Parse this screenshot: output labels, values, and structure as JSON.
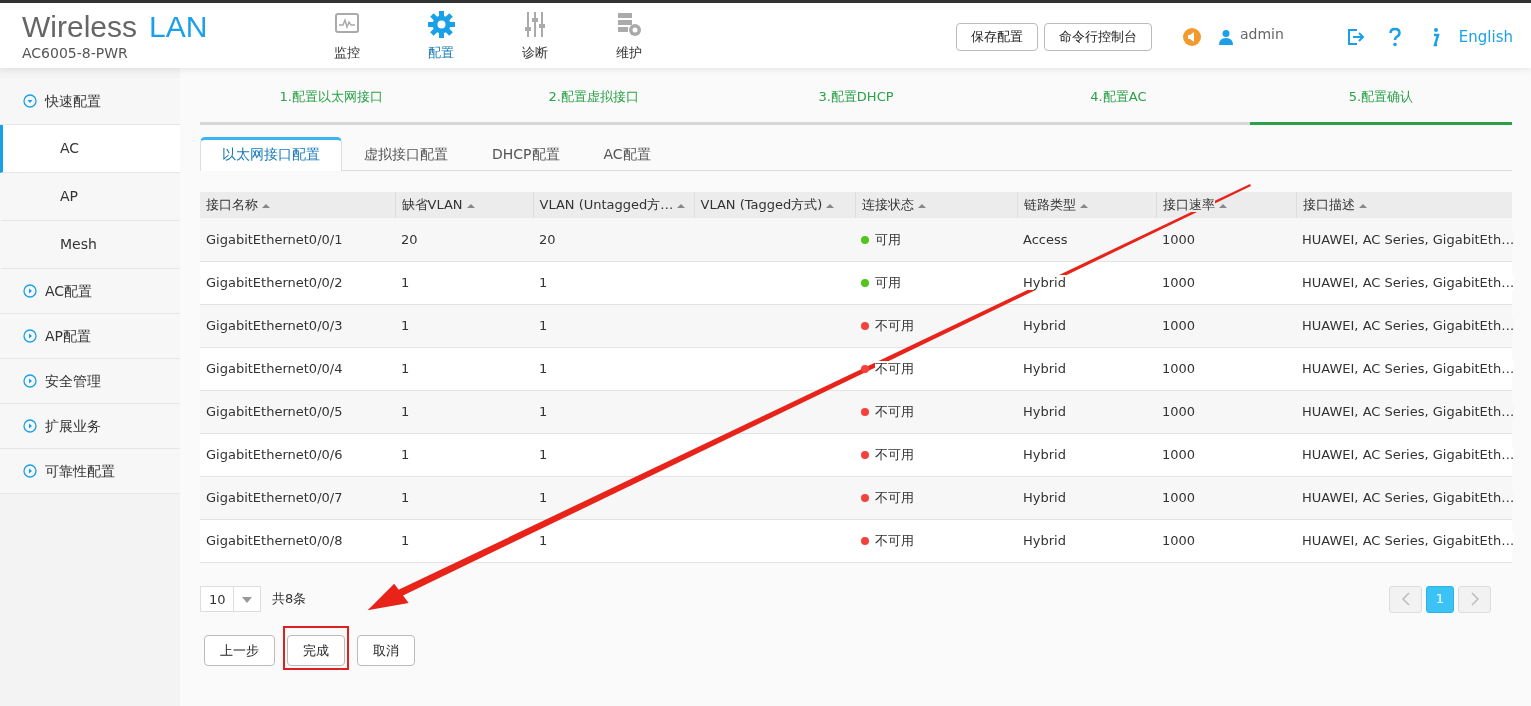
{
  "header": {
    "title_main": "Wireless",
    "title_accent": "LAN",
    "device": "AC6005-8-PWR",
    "nav": [
      {
        "label": "监控",
        "selected": false
      },
      {
        "label": "配置",
        "selected": true
      },
      {
        "label": "诊断",
        "selected": false
      },
      {
        "label": "维护",
        "selected": false
      }
    ],
    "buttons": [
      "保存配置",
      "命令行控制台"
    ],
    "user": "admin",
    "language": "English"
  },
  "sidebar": {
    "items": [
      {
        "label": "快速配置",
        "expanded": true,
        "children": [
          {
            "label": "AC",
            "selected": true
          },
          {
            "label": "AP",
            "selected": false
          },
          {
            "label": "Mesh",
            "selected": false
          }
        ]
      },
      {
        "label": "AC配置",
        "expanded": false
      },
      {
        "label": "AP配置",
        "expanded": false
      },
      {
        "label": "安全管理",
        "expanded": false
      },
      {
        "label": "扩展业务",
        "expanded": false
      },
      {
        "label": "可靠性配置",
        "expanded": false
      }
    ]
  },
  "steps": [
    {
      "label": "1.配置以太网接口",
      "selected": false
    },
    {
      "label": "2.配置虚拟接口",
      "selected": false
    },
    {
      "label": "3.配置DHCP",
      "selected": false
    },
    {
      "label": "4.配置AC",
      "selected": false
    },
    {
      "label": "5.配置确认",
      "selected": true
    }
  ],
  "tabs": [
    {
      "label": "以太网接口配置",
      "selected": true
    },
    {
      "label": "虚拟接口配置",
      "selected": false
    },
    {
      "label": "DHCP配置",
      "selected": false
    },
    {
      "label": "AC配置",
      "selected": false
    }
  ],
  "table": {
    "columns": [
      "接口名称",
      "缺省VLAN",
      "VLAN (Untagged方…",
      "VLAN (Tagged方式)",
      "连接状态",
      "链路类型",
      "接口速率",
      "接口描述"
    ],
    "rows": [
      {
        "name": "GigabitEthernet0/0/1",
        "default_vlan": "20",
        "untagged_vlan": "20",
        "status": "可用",
        "color": "#52c41a",
        "link_type": "Access",
        "speed": "1000",
        "description": "HUAWEI, AC Series, GigabitEth…"
      },
      {
        "name": "GigabitEthernet0/0/2",
        "default_vlan": "1",
        "untagged_vlan": "1",
        "status": "可用",
        "color": "#52c41a",
        "link_type": "Hybrid",
        "speed": "1000",
        "description": "HUAWEI, AC Series, GigabitEth…"
      },
      {
        "name": "GigabitEthernet0/0/3",
        "default_vlan": "1",
        "untagged_vlan": "1",
        "status": "不可用",
        "color": "#f5413d",
        "link_type": "Hybrid",
        "speed": "1000",
        "description": "HUAWEI, AC Series, GigabitEth…"
      },
      {
        "name": "GigabitEthernet0/0/4",
        "default_vlan": "1",
        "untagged_vlan": "1",
        "status": "不可用",
        "color": "#f5413d",
        "link_type": "Hybrid",
        "speed": "1000",
        "description": "HUAWEI, AC Series, GigabitEth…"
      },
      {
        "name": "GigabitEthernet0/0/5",
        "default_vlan": "1",
        "untagged_vlan": "1",
        "status": "不可用",
        "color": "#f5413d",
        "link_type": "Hybrid",
        "speed": "1000",
        "description": "HUAWEI, AC Series, GigabitEth…"
      },
      {
        "name": "GigabitEthernet0/0/6",
        "default_vlan": "1",
        "untagged_vlan": "1",
        "status": "不可用",
        "color": "#f5413d",
        "link_type": "Hybrid",
        "speed": "1000",
        "description": "HUAWEI, AC Series, GigabitEth…"
      },
      {
        "name": "GigabitEthernet0/0/7",
        "default_vlan": "1",
        "untagged_vlan": "1",
        "status": "不可用",
        "color": "#f5413d",
        "link_type": "Hybrid",
        "speed": "1000",
        "description": "HUAWEI, AC Series, GigabitEth…"
      },
      {
        "name": "GigabitEthernet0/0/8",
        "default_vlan": "1",
        "untagged_vlan": "1",
        "status": "不可用",
        "color": "#f5413d",
        "link_type": "Hybrid",
        "speed": "1000",
        "description": "HUAWEI, AC Series, GigabitEth…"
      }
    ]
  },
  "pagination": {
    "page_size": "10",
    "total": "共8条",
    "pages": [
      {
        "label": "1",
        "selected": true
      }
    ]
  },
  "actions": [
    {
      "label": "上一步",
      "highlighted": false
    },
    {
      "label": "完成",
      "highlighted": true
    },
    {
      "label": "取消",
      "highlighted": false
    }
  ]
}
